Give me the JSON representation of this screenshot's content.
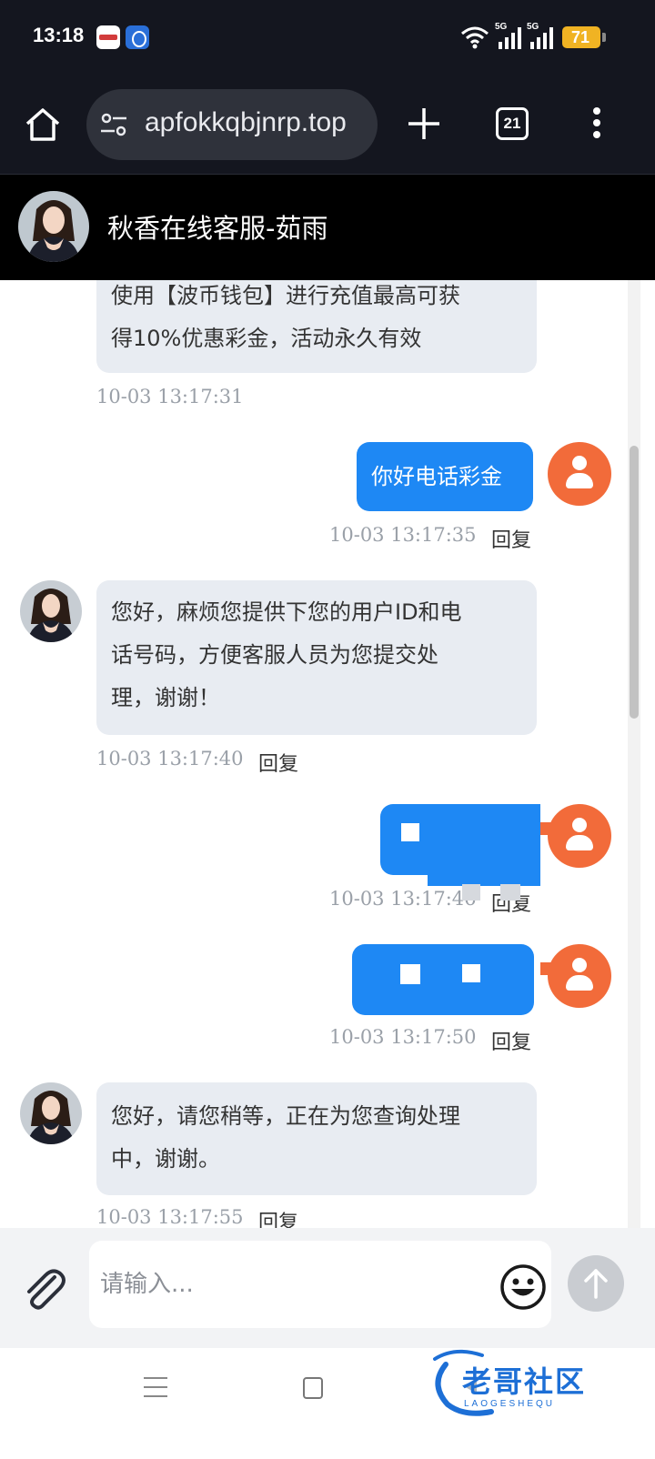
{
  "status_bar": {
    "time": "13:18",
    "network_1": "5G",
    "network_2": "5G",
    "battery": "71"
  },
  "browser": {
    "url": "apfokkqbjnrp.top",
    "tab_count": "21"
  },
  "chat": {
    "title": "秋香在线客服-茹雨",
    "reply_label": "回复",
    "messages": [
      {
        "from": "agent",
        "lines": [
          "使用【波币钱包】进行充值最高可获",
          "得10%优惠彩金，活动永久有效"
        ],
        "time": "10-03 13:17:31"
      },
      {
        "from": "user",
        "lines": [
          "你好电话彩金"
        ],
        "time": "10-03 13:17:35"
      },
      {
        "from": "agent",
        "lines": [
          "您好，麻烦您提供下您的用户ID和电",
          "话号码，方便客服人员为您提交处",
          "理，谢谢！"
        ],
        "time": "10-03 13:17:40"
      },
      {
        "from": "user",
        "lines": [
          "[redacted]"
        ],
        "time": "10-03 13:17:46"
      },
      {
        "from": "user",
        "lines": [
          "[redacted]"
        ],
        "time": "10-03 13:17:50"
      },
      {
        "from": "agent",
        "lines": [
          "您好，请您稍等，正在为您查询处理",
          "中，谢谢。"
        ],
        "time": "10-03 13:17:55"
      }
    ]
  },
  "input": {
    "placeholder": "请输入..."
  },
  "watermark": {
    "title": "老哥社区",
    "subtitle": "LAOGESHEQU"
  }
}
